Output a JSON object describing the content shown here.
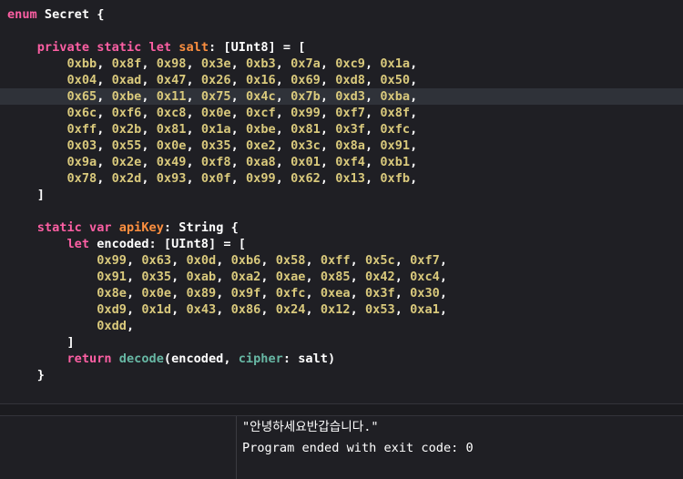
{
  "editor": {
    "lines": [
      {
        "indent": "",
        "tokens": [
          {
            "t": "enum",
            "c": "kw"
          },
          {
            "t": " Secret {",
            "c": "pl"
          }
        ]
      },
      {
        "indent": "",
        "tokens": []
      },
      {
        "indent": "    ",
        "tokens": [
          {
            "t": "private",
            "c": "kw"
          },
          {
            "t": " ",
            "c": "pl"
          },
          {
            "t": "static",
            "c": "kw"
          },
          {
            "t": " ",
            "c": "pl"
          },
          {
            "t": "let",
            "c": "kw"
          },
          {
            "t": " ",
            "c": "pl"
          },
          {
            "t": "salt",
            "c": "decl"
          },
          {
            "t": ": [UInt8] = [",
            "c": "pl"
          }
        ]
      },
      {
        "indent": "        ",
        "hex": [
          "0xbb",
          "0x8f",
          "0x98",
          "0x3e",
          "0xb3",
          "0x7a",
          "0xc9",
          "0x1a"
        ]
      },
      {
        "indent": "        ",
        "hex": [
          "0x04",
          "0xad",
          "0x47",
          "0x26",
          "0x16",
          "0x69",
          "0xd8",
          "0x50"
        ]
      },
      {
        "indent": "        ",
        "hex": [
          "0x65",
          "0xbe",
          "0x11",
          "0x75",
          "0x4c",
          "0x7b",
          "0xd3",
          "0xba"
        ],
        "highlight": true
      },
      {
        "indent": "        ",
        "hex": [
          "0x6c",
          "0xf6",
          "0xc8",
          "0x0e",
          "0xcf",
          "0x99",
          "0xf7",
          "0x8f"
        ]
      },
      {
        "indent": "        ",
        "hex": [
          "0xff",
          "0x2b",
          "0x81",
          "0x1a",
          "0xbe",
          "0x81",
          "0x3f",
          "0xfc"
        ]
      },
      {
        "indent": "        ",
        "hex": [
          "0x03",
          "0x55",
          "0x0e",
          "0x35",
          "0xe2",
          "0x3c",
          "0x8a",
          "0x91"
        ]
      },
      {
        "indent": "        ",
        "hex": [
          "0x9a",
          "0x2e",
          "0x49",
          "0xf8",
          "0xa8",
          "0x01",
          "0xf4",
          "0xb1"
        ]
      },
      {
        "indent": "        ",
        "hex": [
          "0x78",
          "0x2d",
          "0x93",
          "0x0f",
          "0x99",
          "0x62",
          "0x13",
          "0xfb"
        ]
      },
      {
        "indent": "    ",
        "tokens": [
          {
            "t": "]",
            "c": "pl"
          }
        ]
      },
      {
        "indent": "",
        "tokens": []
      },
      {
        "indent": "    ",
        "tokens": [
          {
            "t": "static",
            "c": "kw"
          },
          {
            "t": " ",
            "c": "pl"
          },
          {
            "t": "var",
            "c": "kw"
          },
          {
            "t": " ",
            "c": "pl"
          },
          {
            "t": "apiKey",
            "c": "decl"
          },
          {
            "t": ": String {",
            "c": "pl"
          }
        ]
      },
      {
        "indent": "        ",
        "tokens": [
          {
            "t": "let",
            "c": "kw"
          },
          {
            "t": " encoded: [UInt8] = [",
            "c": "pl"
          }
        ]
      },
      {
        "indent": "            ",
        "hex": [
          "0x99",
          "0x63",
          "0x0d",
          "0xb6",
          "0x58",
          "0xff",
          "0x5c",
          "0xf7"
        ]
      },
      {
        "indent": "            ",
        "hex": [
          "0x91",
          "0x35",
          "0xab",
          "0xa2",
          "0xae",
          "0x85",
          "0x42",
          "0xc4"
        ]
      },
      {
        "indent": "            ",
        "hex": [
          "0x8e",
          "0x0e",
          "0x89",
          "0x9f",
          "0xfc",
          "0xea",
          "0x3f",
          "0x30"
        ]
      },
      {
        "indent": "            ",
        "hex": [
          "0xd9",
          "0x1d",
          "0x43",
          "0x86",
          "0x24",
          "0x12",
          "0x53",
          "0xa1"
        ]
      },
      {
        "indent": "            ",
        "hex": [
          "0xdd"
        ]
      },
      {
        "indent": "        ",
        "tokens": [
          {
            "t": "]",
            "c": "pl"
          }
        ]
      },
      {
        "indent": "        ",
        "tokens": [
          {
            "t": "return",
            "c": "kw"
          },
          {
            "t": " ",
            "c": "pl"
          },
          {
            "t": "decode",
            "c": "fn"
          },
          {
            "t": "(encoded, ",
            "c": "pl"
          },
          {
            "t": "cipher",
            "c": "fn"
          },
          {
            "t": ": salt)",
            "c": "pl"
          }
        ]
      },
      {
        "indent": "    ",
        "tokens": [
          {
            "t": "}",
            "c": "pl"
          }
        ]
      }
    ]
  },
  "console": {
    "output": "\"안녕하세요반갑습니다.\"",
    "status": "Program ended with exit code: 0"
  }
}
